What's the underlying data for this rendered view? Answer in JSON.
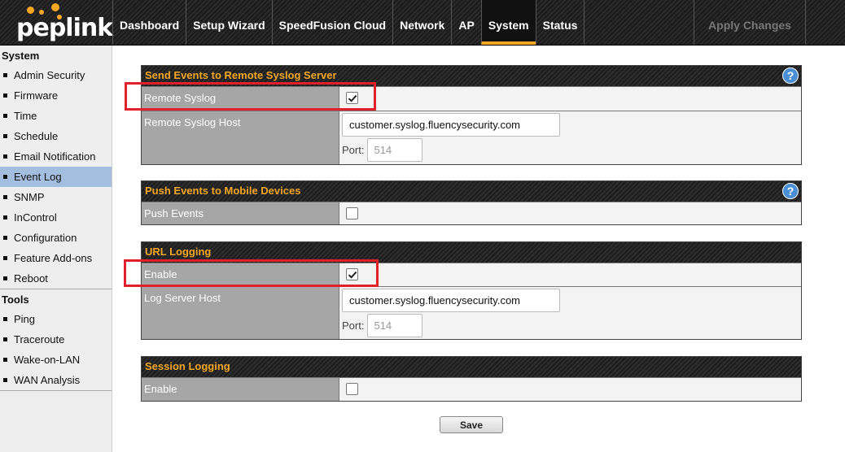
{
  "brand": {
    "logo_text": "peplink"
  },
  "nav": {
    "items": [
      "Dashboard",
      "Setup Wizard",
      "SpeedFusion Cloud",
      "Network",
      "AP",
      "System",
      "Status"
    ],
    "active": "System",
    "apply_label": "Apply Changes"
  },
  "sidebar": {
    "system_heading": "System",
    "system_items": [
      "Admin Security",
      "Firmware",
      "Time",
      "Schedule",
      "Email Notification",
      "Event Log",
      "SNMP",
      "InControl",
      "Configuration",
      "Feature Add-ons",
      "Reboot"
    ],
    "active": "Event Log",
    "tools_heading": "Tools",
    "tools_items": [
      "Ping",
      "Traceroute",
      "Wake-on-LAN",
      "WAN Analysis"
    ]
  },
  "remote_syslog": {
    "title": "Send Events to Remote Syslog Server",
    "help": "?",
    "enable_label": "Remote Syslog",
    "enabled": true,
    "host_label": "Remote Syslog Host",
    "host_value": "customer.syslog.fluencysecurity.com",
    "port_label": "Port:",
    "port_placeholder": "514"
  },
  "push_events": {
    "title": "Push Events to Mobile Devices",
    "help": "?",
    "label": "Push Events",
    "enabled": false
  },
  "url_logging": {
    "title": "URL Logging",
    "enable_label": "Enable",
    "enabled": true,
    "host_label": "Log Server Host",
    "host_value": "customer.syslog.fluencysecurity.com",
    "port_label": "Port:",
    "port_placeholder": "514"
  },
  "session_logging": {
    "title": "Session Logging",
    "enable_label": "Enable",
    "enabled": false
  },
  "save_label": "Save",
  "colors": {
    "accent": "#f5a623",
    "highlight": "#e0202a",
    "active_side": "#a3bedf"
  }
}
